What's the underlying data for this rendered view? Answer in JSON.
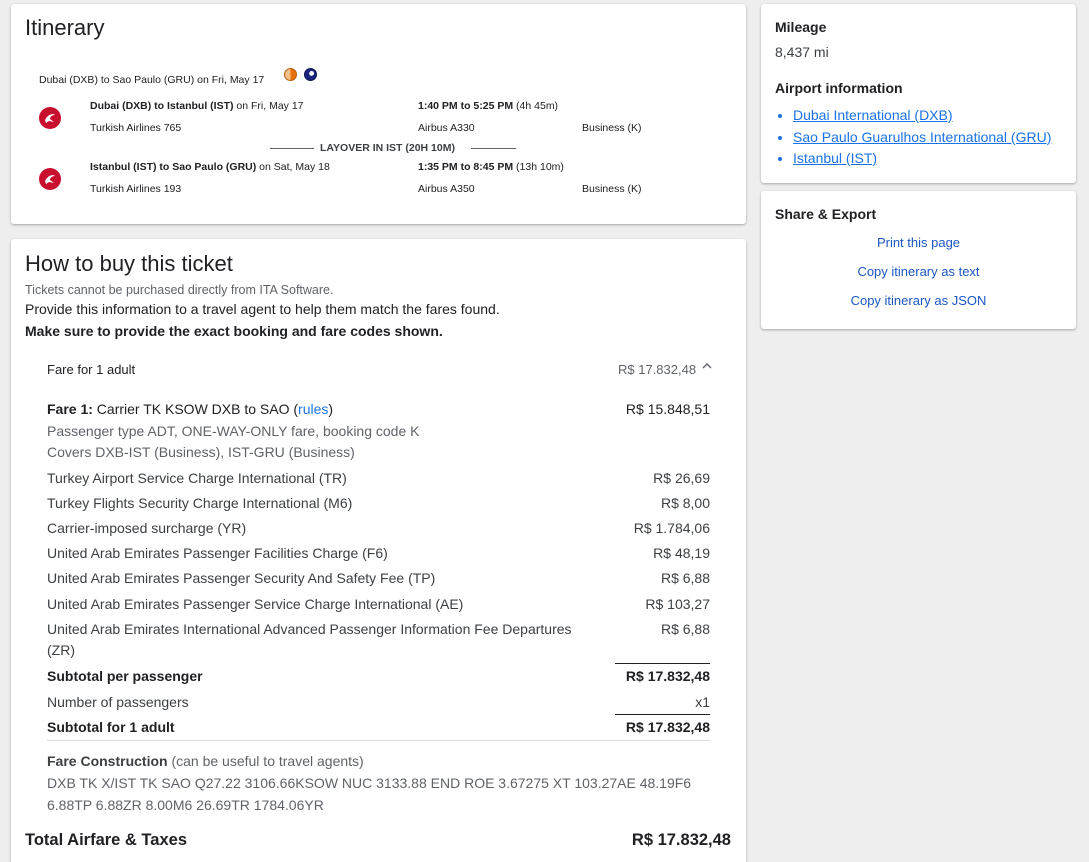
{
  "itinerary": {
    "title": "Itinerary",
    "route_summary": "Dubai (DXB) to Sao Paulo (GRU) on Fri, May 17",
    "legs": [
      {
        "route": "Dubai (DXB) to Istanbul (IST)",
        "date": " on Fri, May 17",
        "time": "1:40 PM to 5:25 PM",
        "duration": " (4h 45m)",
        "flight": "Turkish Airlines 765",
        "aircraft": "Airbus A330",
        "cabin": "Business (K)"
      },
      {
        "route": "Istanbul (IST) to Sao Paulo (GRU)",
        "date": " on Sat, May 18",
        "time": "1:35 PM to 8:45 PM",
        "duration": " (13h 10m)",
        "flight": "Turkish Airlines 193",
        "aircraft": "Airbus A350",
        "cabin": "Business (K)"
      }
    ],
    "layover": "LAYOVER IN IST (20H 10M)"
  },
  "buy": {
    "title": "How to buy this ticket",
    "note": "Tickets cannot be purchased directly from ITA Software.",
    "line1": "Provide this information to a travel agent to help them match the fares found.",
    "line2": "Make sure to provide the exact booking and fare codes shown.",
    "fare_header": "Fare for 1 adult",
    "fare_header_value": "R$ 17.832,48",
    "fare1_label": "Fare 1:",
    "fare1_text": " Carrier TK KSOW DXB to SAO (",
    "fare1_rules": "rules",
    "fare1_close": ")",
    "fare1_value": "R$ 15.848,51",
    "fare1_detail1": "Passenger type ADT, ONE-WAY-ONLY fare, booking code K",
    "fare1_detail2": "Covers DXB-IST (Business), IST-GRU (Business)",
    "taxes": [
      {
        "label": "Turkey Airport Service Charge International (TR)",
        "value": "R$ 26,69"
      },
      {
        "label": "Turkey Flights Security Charge International (M6)",
        "value": "R$ 8,00"
      },
      {
        "label": "Carrier-imposed surcharge (YR)",
        "value": "R$ 1.784,06"
      },
      {
        "label": "United Arab Emirates Passenger Facilities Charge (F6)",
        "value": "R$ 48,19"
      },
      {
        "label": "United Arab Emirates Passenger Security And Safety Fee (TP)",
        "value": "R$ 6,88"
      },
      {
        "label": "United Arab Emirates Passenger Service Charge International (AE)",
        "value": "R$ 103,27"
      },
      {
        "label": "United Arab Emirates International Advanced Passenger Information Fee Departures",
        "label2": "(ZR)",
        "value": "R$ 6,88"
      }
    ],
    "subtotal_pp_label": "Subtotal per passenger",
    "subtotal_pp_value": "R$ 17.832,48",
    "num_pass_label": "Number of passengers",
    "num_pass_value": "x1",
    "subtotal_adult_label": "Subtotal for 1 adult",
    "subtotal_adult_value": "R$ 17.832,48",
    "fc_label": "Fare Construction",
    "fc_note": " (can be useful to travel agents)",
    "fc_line1": "DXB TK X/IST TK SAO Q27.22 3106.66KSOW NUC 3133.88 END ROE 3.67275 XT 103.27AE 48.19F6",
    "fc_line2": "6.88TP 6.88ZR 8.00M6 26.69TR 1784.06YR",
    "total_label": "Total Airfare & Taxes",
    "total_value": "R$ 17.832,48"
  },
  "side": {
    "mileage_title": "Mileage",
    "mileage_value": "8,437 mi",
    "airport_title": "Airport information",
    "airports": [
      "Dubai International (DXB)",
      "Sao Paulo Guarulhos International (GRU)",
      "Istanbul (IST)"
    ],
    "share_title": "Share & Export",
    "share_links": [
      "Print this page",
      "Copy itinerary as text",
      "Copy itinerary as JSON"
    ]
  },
  "colors": {
    "airline_red": "#c8102e",
    "link_blue": "#1a73e8"
  },
  "icons": {
    "airline": "turkish-airlines-logo-icon",
    "expand": "chevron-up-icon"
  }
}
